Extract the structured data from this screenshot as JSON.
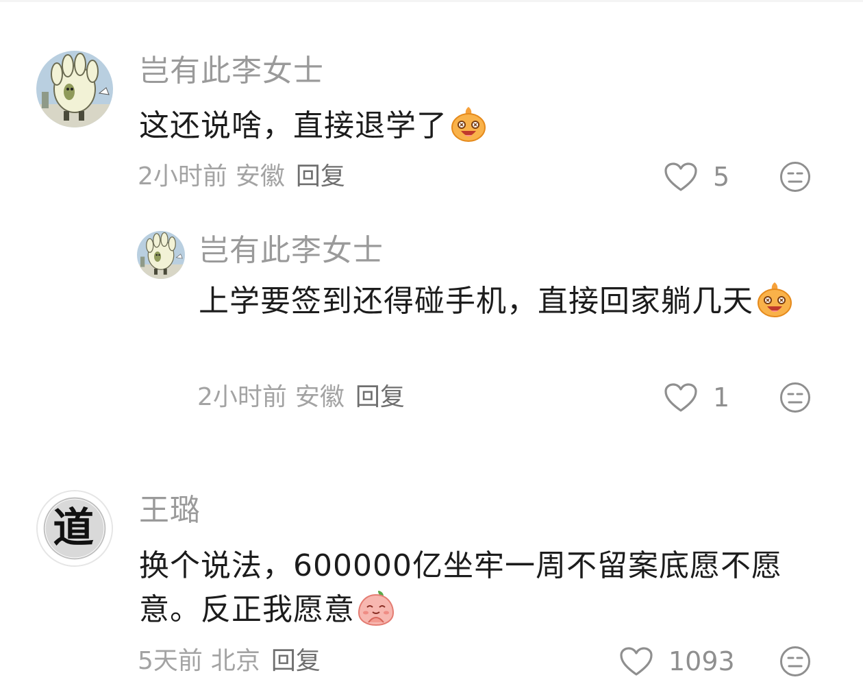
{
  "comments": [
    {
      "username": "岂有此李女士",
      "text": "这还说啥，直接退学了",
      "emoji": "laughing-bun-emoji",
      "time": "2小时前",
      "location": "安徽",
      "reply_label": "回复",
      "likes": "5",
      "replies": [
        {
          "username": "岂有此李女士",
          "text": "上学要签到还得碰手机，直接回家躺几天",
          "emoji": "laughing-bun-emoji",
          "time": "2小时前",
          "location": "安徽",
          "reply_label": "回复",
          "likes": "1"
        }
      ]
    },
    {
      "username": "王璐",
      "text": "换个说法，600000亿坐牢一周不留案底愿不愿意。反正我愿意",
      "emoji": "praying-peach-emoji",
      "avatar_glyph": "道",
      "time": "5天前",
      "location": "北京",
      "reply_label": "回复",
      "likes": "1093"
    }
  ],
  "icons": {
    "like": "heart-outline-icon",
    "dislike": "meh-face-icon"
  },
  "colors": {
    "username": "#9a9a9a",
    "text": "#1c1c1c",
    "meta": "#a3a3a3",
    "icon": "#8f8f8f"
  }
}
